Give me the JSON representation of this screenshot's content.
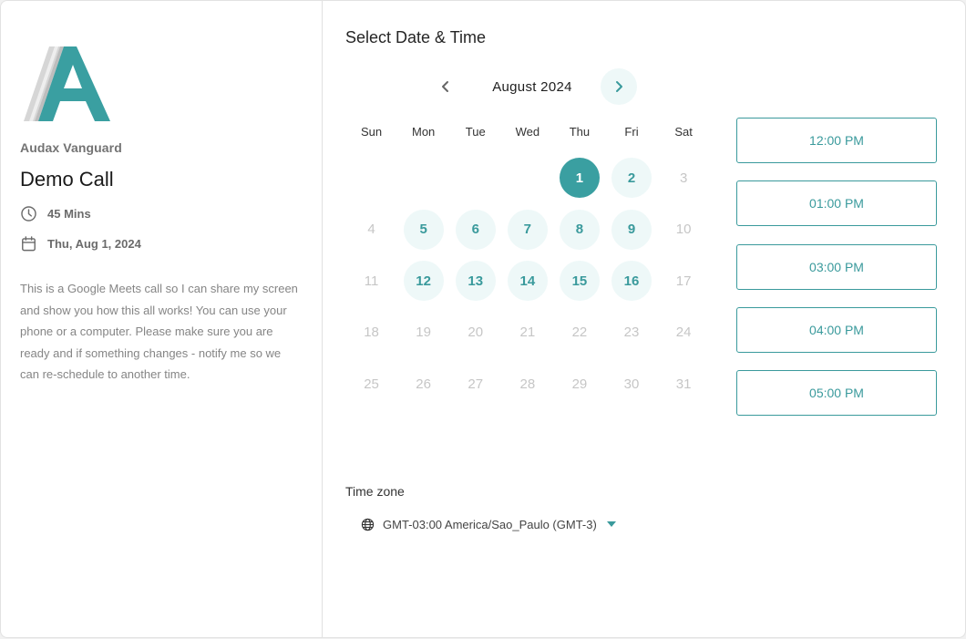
{
  "brand": {
    "org_name": "Audax Vanguard",
    "logo_icon": "audax-a-logo",
    "accent_color": "#3a9fa1"
  },
  "event": {
    "title": "Demo Call",
    "duration": "45 Mins",
    "duration_icon": "clock-icon",
    "date": "Thu, Aug 1, 2024",
    "date_icon": "calendar-icon",
    "description": "This is a Google Meets call so I can share my screen and show you how this all works! You can use your phone or a computer. Please make sure you are ready and if something changes - notify me so we can re-schedule to another time."
  },
  "scheduler": {
    "title": "Select Date & Time",
    "month_label": "August 2024",
    "prev_icon": "chevron-left-icon",
    "next_icon": "chevron-right-icon",
    "weekdays": [
      "Sun",
      "Mon",
      "Tue",
      "Wed",
      "Thu",
      "Fri",
      "Sat"
    ],
    "weeks": [
      [
        {
          "label": "",
          "state": "empty"
        },
        {
          "label": "",
          "state": "empty"
        },
        {
          "label": "",
          "state": "empty"
        },
        {
          "label": "",
          "state": "empty"
        },
        {
          "label": "1",
          "state": "selected"
        },
        {
          "label": "2",
          "state": "available"
        },
        {
          "label": "3",
          "state": "disabled"
        }
      ],
      [
        {
          "label": "4",
          "state": "disabled"
        },
        {
          "label": "5",
          "state": "available"
        },
        {
          "label": "6",
          "state": "available"
        },
        {
          "label": "7",
          "state": "available"
        },
        {
          "label": "8",
          "state": "available"
        },
        {
          "label": "9",
          "state": "available"
        },
        {
          "label": "10",
          "state": "disabled"
        }
      ],
      [
        {
          "label": "11",
          "state": "disabled"
        },
        {
          "label": "12",
          "state": "available"
        },
        {
          "label": "13",
          "state": "available"
        },
        {
          "label": "14",
          "state": "available"
        },
        {
          "label": "15",
          "state": "available"
        },
        {
          "label": "16",
          "state": "available"
        },
        {
          "label": "17",
          "state": "disabled"
        }
      ],
      [
        {
          "label": "18",
          "state": "disabled"
        },
        {
          "label": "19",
          "state": "disabled"
        },
        {
          "label": "20",
          "state": "disabled"
        },
        {
          "label": "21",
          "state": "disabled"
        },
        {
          "label": "22",
          "state": "disabled"
        },
        {
          "label": "23",
          "state": "disabled"
        },
        {
          "label": "24",
          "state": "disabled"
        }
      ],
      [
        {
          "label": "25",
          "state": "disabled"
        },
        {
          "label": "26",
          "state": "disabled"
        },
        {
          "label": "27",
          "state": "disabled"
        },
        {
          "label": "28",
          "state": "disabled"
        },
        {
          "label": "29",
          "state": "disabled"
        },
        {
          "label": "30",
          "state": "disabled"
        },
        {
          "label": "31",
          "state": "disabled"
        }
      ]
    ],
    "time_slots": [
      "12:00 PM",
      "01:00 PM",
      "03:00 PM",
      "04:00 PM",
      "05:00 PM"
    ],
    "timezone": {
      "label": "Time zone",
      "icon": "globe-icon",
      "value": "GMT-03:00 America/Sao_Paulo (GMT-3)"
    }
  }
}
